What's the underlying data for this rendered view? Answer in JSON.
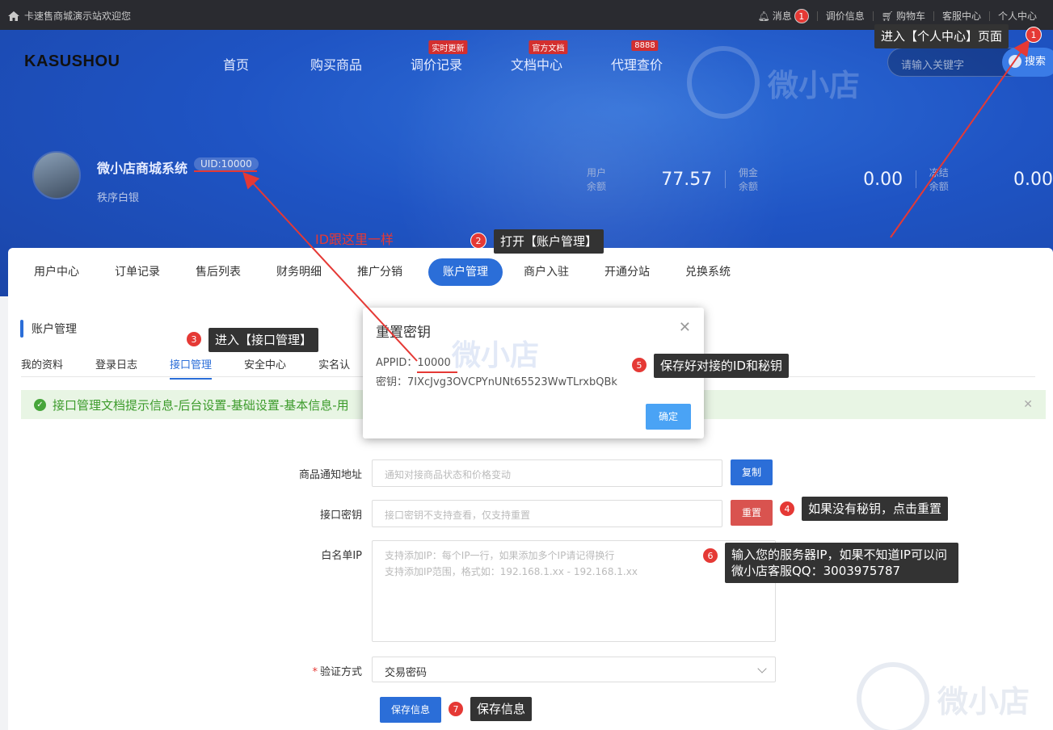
{
  "topbar": {
    "welcome": "卡速售商城演示站欢迎您",
    "links": [
      {
        "label": "消息",
        "badge": "1"
      },
      {
        "label": "调价信息"
      },
      {
        "label": "购物车"
      },
      {
        "label": "客服中心"
      },
      {
        "label": "个人中心"
      }
    ]
  },
  "header": {
    "logo": "KASUSHOU",
    "nav": [
      {
        "label": "首页",
        "tag": ""
      },
      {
        "label": "购买商品",
        "tag": ""
      },
      {
        "label": "调价记录",
        "tag": "实时更新"
      },
      {
        "label": "文档中心",
        "tag": "官方文档"
      },
      {
        "label": "代理查价",
        "tag": "8888"
      }
    ],
    "search_placeholder": "请输入关键字",
    "search_button": "搜索",
    "watermark": "微小店"
  },
  "profile": {
    "name": "微小店商城系统",
    "uid": "UID:10000",
    "level": "秩序白银",
    "stats": [
      {
        "label": "用户余额",
        "value": "77.57"
      },
      {
        "label": "佣金余额",
        "value": "0.00"
      },
      {
        "label": "冻结余额",
        "value": "0.00"
      }
    ]
  },
  "tabs": [
    "用户中心",
    "订单记录",
    "售后列表",
    "财务明细",
    "推广分销",
    "账户管理",
    "商户入驻",
    "开通分站",
    "兑换系统"
  ],
  "active_tab": "账户管理",
  "section": {
    "title": "账户管理",
    "subtabs": [
      "我的资料",
      "登录日志",
      "接口管理",
      "安全中心",
      "实名认"
    ],
    "alert": "接口管理文档提示信息-后台设置-基础设置-基本信息-用"
  },
  "form": {
    "notify_label": "商品通知地址",
    "notify_placeholder": "通知对接商品状态和价格变动",
    "copy_button": "复制",
    "key_label": "接口密钥",
    "key_placeholder": "接口密钥不支持查看，仅支持重置",
    "reset_button": "重置",
    "whitelist_label": "白名单IP",
    "whitelist_line1": "支持添加IP：每个IP一行，如果添加多个IP请记得换行",
    "whitelist_line2": "支持添加IP范围，格式如：192.168.1.xx - 192.168.1.xx",
    "verify_label": "验证方式",
    "verify_value": "交易密码",
    "save_button": "保存信息"
  },
  "modal": {
    "title": "重置密钥",
    "appid_label": "APPID：",
    "appid_value": "10000",
    "secret_label": "密钥：",
    "secret_value": "7IXcJvg3OVCPYnUNt65523WwTLrxbQBk",
    "ok_button": "确定"
  },
  "annotations": {
    "step1": "进入【个人中心】页面",
    "step2": "打开【账户管理】",
    "step3": "进入【接口管理】",
    "step4": "如果没有秘钥，点击重置",
    "step5": "保存好对接的ID和秘钥",
    "step6": "输入您的服务器IP，如果不知道IP可以问微小店客服QQ：3003975787",
    "step7": "保存信息",
    "id_note": "ID跟这里一样",
    "nums": [
      "1",
      "2",
      "3",
      "4",
      "5",
      "6",
      "7"
    ]
  },
  "colors": {
    "brand_blue": "#2b6ed8",
    "annotation_red": "#e53935",
    "banner_blue": "#1f54c4"
  }
}
